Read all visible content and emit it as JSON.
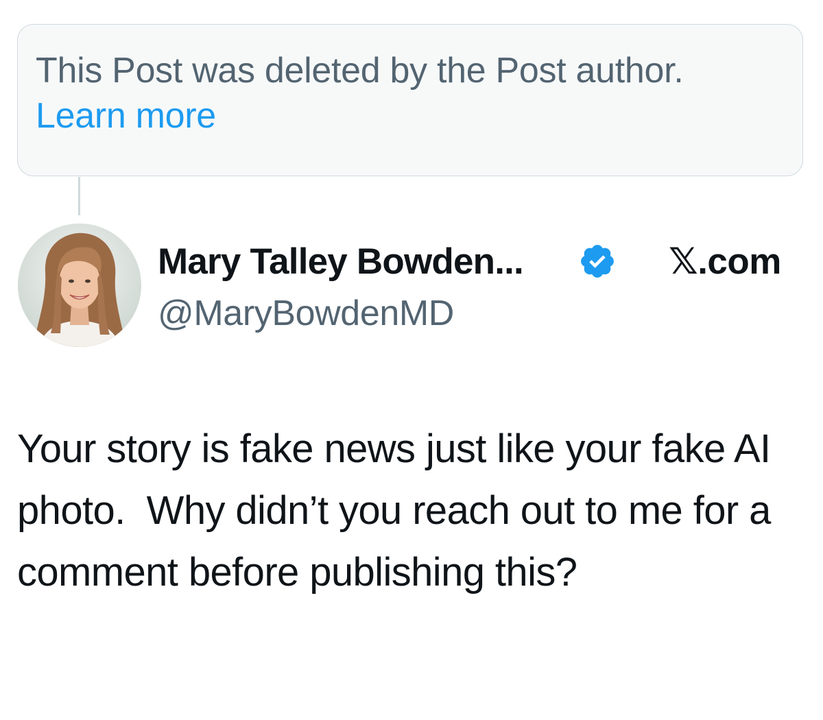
{
  "deleted_notice": {
    "text": "This Post was deleted by the Post author.",
    "link_label": "Learn more",
    "link_color": "#1d9bf0",
    "background": "#f7f9f9"
  },
  "author": {
    "display_name": "Mary Talley Bowden...",
    "handle": "@MaryBowdenMD",
    "verified": true,
    "verified_icon": "verified-badge-icon",
    "verified_color": "#1d9bf0",
    "avatar_icon": "user-avatar-photo"
  },
  "site_label": "𝕏.com",
  "post": {
    "text": "Your story is fake news just like your fake AI photo.  Why didn’t you reach out to me for a comment before publishing this?"
  }
}
